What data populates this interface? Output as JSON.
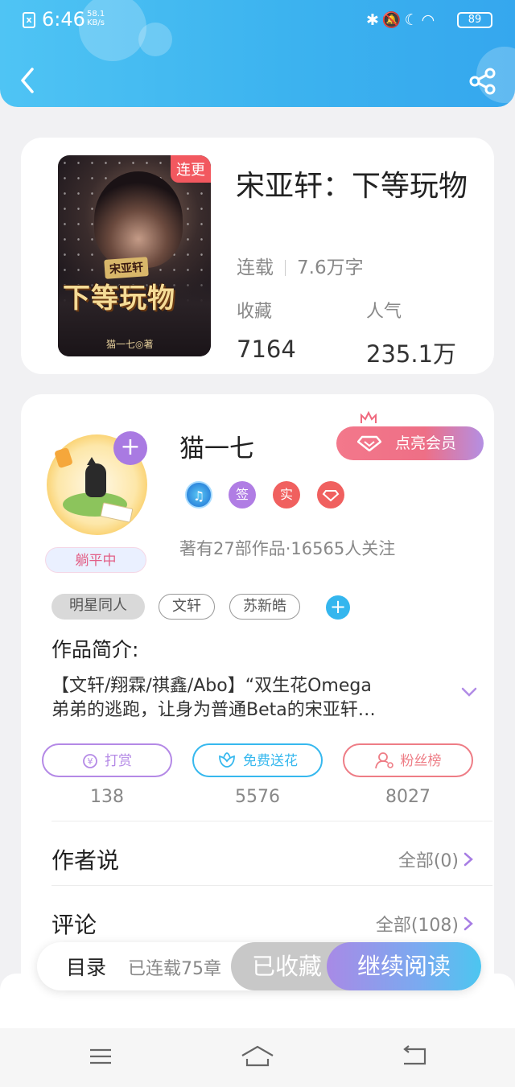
{
  "status_bar": {
    "time": "6:46",
    "net_speed_value": "58.1",
    "net_speed_unit": "KB/s",
    "battery": "89"
  },
  "header": {
    "back_icon": "chevron-left-icon",
    "share_icon": "share-icon"
  },
  "book": {
    "cover_badge": "连更",
    "cover_subtitle": "宋亚轩",
    "cover_title": "下等玩物",
    "cover_author": "猫一七◎著",
    "title": "宋亚轩：下等玩物",
    "status": "连载",
    "word_count": "7.6万字",
    "favorites_label": "收藏",
    "favorites_value": "7164",
    "popularity_label": "人气",
    "popularity_value": "235.1万"
  },
  "author": {
    "name": "猫一七",
    "status_pill": "躺平中",
    "vip_label": "点亮会员",
    "badges": [
      "签",
      "实"
    ],
    "info": "著有27部作品·16565人关注"
  },
  "tags": [
    "明星同人",
    "文轩",
    "苏新皓"
  ],
  "intro": {
    "title": "作品简介:",
    "line1": "【文轩/翔霖/祺鑫/Abo】“双生花Omega",
    "line2": "弟弟的逃跑，让身为普通Beta的宋亚轩…"
  },
  "actions": [
    {
      "label": "打赏",
      "count": "138",
      "color": "#b489e6"
    },
    {
      "label": "免费送花",
      "count": "5576",
      "color": "#36b8ee"
    },
    {
      "label": "粉丝榜",
      "count": "8027",
      "color": "#ee7d86"
    }
  ],
  "author_says": {
    "title": "作者说",
    "link": "全部(0)"
  },
  "comments": {
    "title": "评论",
    "link": "全部(108)"
  },
  "bottom_bar": {
    "toc": "目录",
    "chapters": "已连载75章",
    "favorited": "已收藏",
    "continue": "继续阅读"
  },
  "colors": {
    "header": "#3cb3ef",
    "accent_purple": "#a97ae2",
    "vip_pink": "#ee6f86",
    "badge_red": "#f2585f"
  }
}
